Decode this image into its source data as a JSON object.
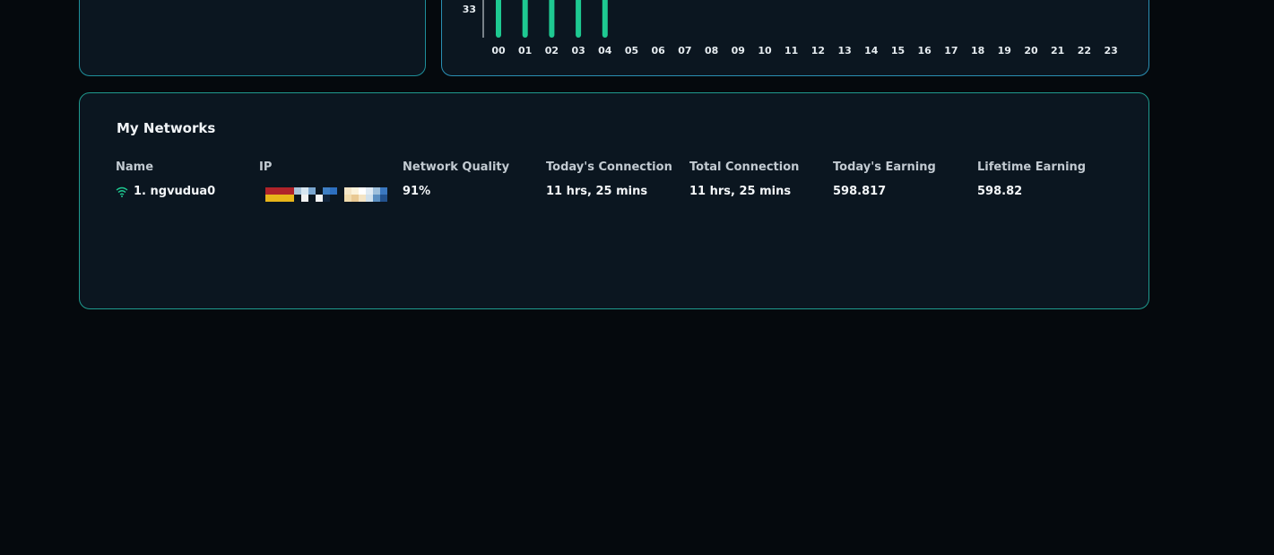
{
  "chart_data": {
    "type": "bar",
    "categories": [
      "00",
      "01",
      "02",
      "03",
      "04",
      "05",
      "06",
      "07",
      "08",
      "09",
      "10",
      "11",
      "12",
      "13",
      "14",
      "15",
      "16",
      "17",
      "18",
      "19",
      "20",
      "21",
      "22",
      "23"
    ],
    "values": [
      60,
      60,
      60,
      60,
      45,
      0,
      0,
      0,
      0,
      0,
      0,
      0,
      0,
      0,
      0,
      0,
      0,
      0,
      0,
      0,
      0,
      0,
      0,
      0
    ],
    "y_tick_visible": "33",
    "bar_color": "#1ec991"
  },
  "networks": {
    "title": "My Networks",
    "columns": [
      "Name",
      "IP",
      "Network Quality",
      "Today's Connection",
      "Total Connection",
      "Today's Earning",
      "Lifetime Earning"
    ],
    "rows": [
      {
        "name": "1. ngvudua0",
        "network_quality": "91%",
        "todays_connection": "11 hrs, 25 mins",
        "total_connection": "11 hrs, 25 mins",
        "todays_earning": "598.817",
        "lifetime_earning": "598.82"
      }
    ]
  },
  "colors": {
    "accent": "#1ec991",
    "panel_bg": "#0b1620",
    "page_bg": "#05090d"
  },
  "icons": {
    "network_status": "wifi-icon"
  }
}
